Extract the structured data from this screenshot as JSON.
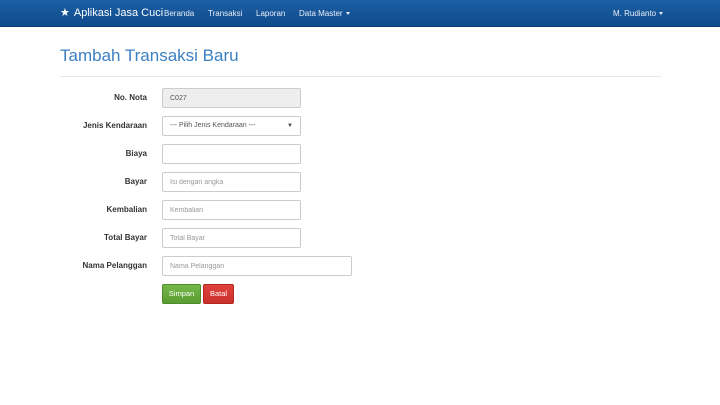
{
  "navbar": {
    "brand": "Aplikasi Jasa Cuci",
    "items": [
      {
        "label": "Beranda"
      },
      {
        "label": "Transaksi"
      },
      {
        "label": "Laporan"
      },
      {
        "label": "Data Master"
      }
    ],
    "user": "M. Rudianto",
    "accent_color": "#1558a0"
  },
  "page": {
    "title": "Tambah Transaksi Baru"
  },
  "form": {
    "no_nota": {
      "label": "No. Nota",
      "value": "C027"
    },
    "jenis_kendaraan": {
      "label": "Jenis Kendaraan",
      "selected": "--- Pilih Jenis Kendaraan ---"
    },
    "biaya": {
      "label": "Biaya",
      "value": "",
      "placeholder": ""
    },
    "bayar": {
      "label": "Bayar",
      "value": "",
      "placeholder": "Isi dengan angka"
    },
    "kembalian": {
      "label": "Kembalian",
      "value": "",
      "placeholder": "Kembalian"
    },
    "total_bayar": {
      "label": "Total Bayar",
      "value": "",
      "placeholder": "Total Bayar"
    },
    "nama_pelanggan": {
      "label": "Nama Pelanggan",
      "value": "",
      "placeholder": "Nama Pelanggan"
    },
    "save_label": "Simpan",
    "cancel_label": "Batal"
  }
}
